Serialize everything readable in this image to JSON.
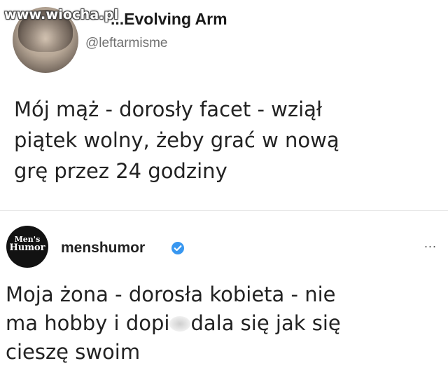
{
  "watermark": "www.wiocha.pl",
  "tweet": {
    "display_name": "...Evolving Arm",
    "handle": "@leftarmisme",
    "text_lines": [
      "Mój mąż - dorosły facet - wziął",
      "piątek wolny, żeby grać w nową",
      "grę przez 24 godziny"
    ]
  },
  "post": {
    "avatar_text": [
      "Men's",
      "Humor"
    ],
    "username": "menshumor",
    "more": "...",
    "text_line_1": "Moja żona - dorosła kobieta - nie",
    "text_line_2a": "ma hobby i dopi",
    "text_line_2b": "dala się jak się",
    "text_line_3": "cieszę swoim"
  },
  "colors": {
    "verified": "#3897f0",
    "handle": "#6f6f6f"
  }
}
